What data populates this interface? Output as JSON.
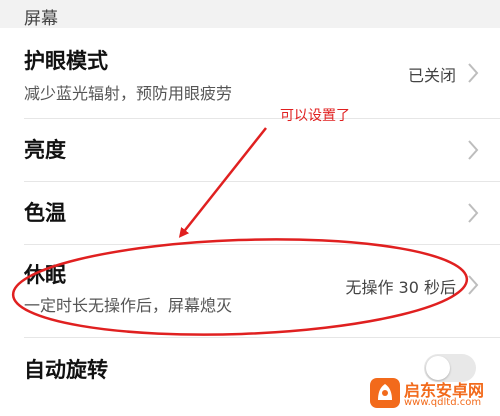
{
  "section": {
    "title": "屏幕"
  },
  "rows": [
    {
      "title": "护眼模式",
      "subtitle": "减少蓝光辐射，预防用眼疲劳",
      "value": "已关闭",
      "icon": "chevron-right-icon"
    },
    {
      "title": "亮度",
      "icon": "chevron-right-icon"
    },
    {
      "title": "色温",
      "icon": "chevron-right-icon"
    },
    {
      "title": "休眠",
      "subtitle": "一定时长无操作后，屏幕熄灭",
      "value": "无操作 30 秒后",
      "icon": "chevron-right-icon"
    },
    {
      "title": "自动旋转",
      "toggle_on": false
    }
  ],
  "annotation": {
    "text": "可以设置了",
    "color": "#e02020"
  },
  "watermark": {
    "name": "启东安卓网",
    "url": "www.qdltd.com",
    "color": "#f26a1b"
  },
  "colors": {
    "accent_red": "#e02020",
    "background": "#f2f2f2"
  }
}
